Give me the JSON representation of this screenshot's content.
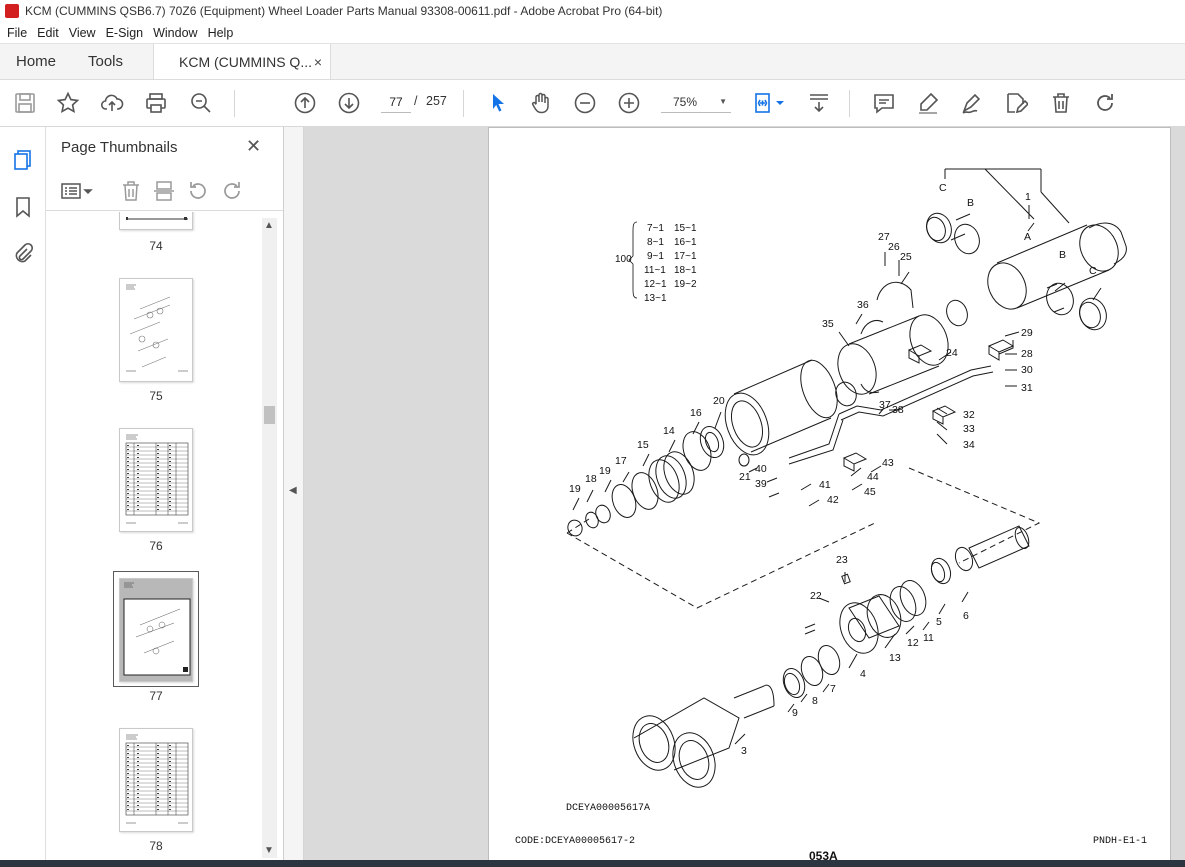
{
  "window": {
    "title": "KCM (CUMMINS QSB6.7) 70Z6 (Equipment) Wheel Loader Parts Manual 93308-00611.pdf - Adobe Acrobat Pro (64-bit)"
  },
  "menu": [
    "File",
    "Edit",
    "View",
    "E-Sign",
    "Window",
    "Help"
  ],
  "tabs": {
    "home": "Home",
    "tools": "Tools",
    "document": "KCM (CUMMINS Q...",
    "close": "×"
  },
  "toolbar": {
    "current_page": "77",
    "page_separator": "/",
    "total_pages": "257",
    "zoom": "75%",
    "zoom_caret": "▼"
  },
  "panel": {
    "title": "Page Thumbnails",
    "close": "✕"
  },
  "thumbnails": [
    {
      "label": "74"
    },
    {
      "label": "75"
    },
    {
      "label": "76"
    },
    {
      "label": "77",
      "selected": true
    },
    {
      "label": "78"
    }
  ],
  "document": {
    "diagram_code": "DCEYA00005617A",
    "code_line": "CODE:DCEYA00005617-2",
    "page_ref": "PNDH-E1-1",
    "page_number": "053A",
    "group_label": "100",
    "group_items_left": [
      "7~1",
      "8~1",
      "9~1",
      "11~1",
      "12~1",
      "13~1"
    ],
    "group_items_right": [
      "15~1",
      "16~1",
      "17~1",
      "18~1",
      "19~2"
    ],
    "callouts": [
      "1",
      "A",
      "B",
      "C",
      "B",
      "C",
      "27",
      "26",
      "25",
      "36",
      "35",
      "24",
      "28",
      "29",
      "30",
      "31",
      "37",
      "38",
      "32",
      "33",
      "34",
      "20",
      "16",
      "14",
      "15",
      "17",
      "19",
      "18",
      "19",
      "21",
      "40",
      "39",
      "41",
      "42",
      "43",
      "44",
      "45",
      "23",
      "22",
      "4",
      "13",
      "12",
      "11",
      "5",
      "6",
      "9",
      "8",
      "7",
      "3"
    ]
  },
  "colors": {
    "accent_blue": "#1473e6",
    "doc_area_bg": "#dadada",
    "taskbar": "#2d3540"
  }
}
